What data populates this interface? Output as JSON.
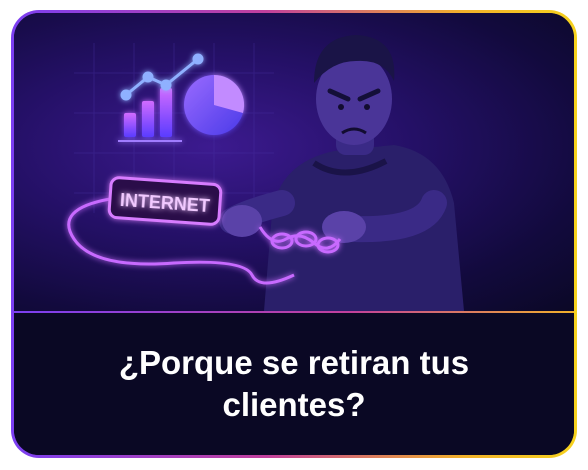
{
  "card": {
    "title": "¿Porque se retiran tus clientes?"
  },
  "illustration": {
    "sign_text": "INTERNET",
    "icons": [
      "bar-chart-icon",
      "trend-line-icon",
      "pie-chart-icon",
      "cable-plug-icon"
    ]
  },
  "colors": {
    "background": "#08061f",
    "neon_accent": "#c86bff",
    "border_start": "#7b3ff2",
    "border_end": "#f6d21e",
    "text": "#ffffff"
  }
}
